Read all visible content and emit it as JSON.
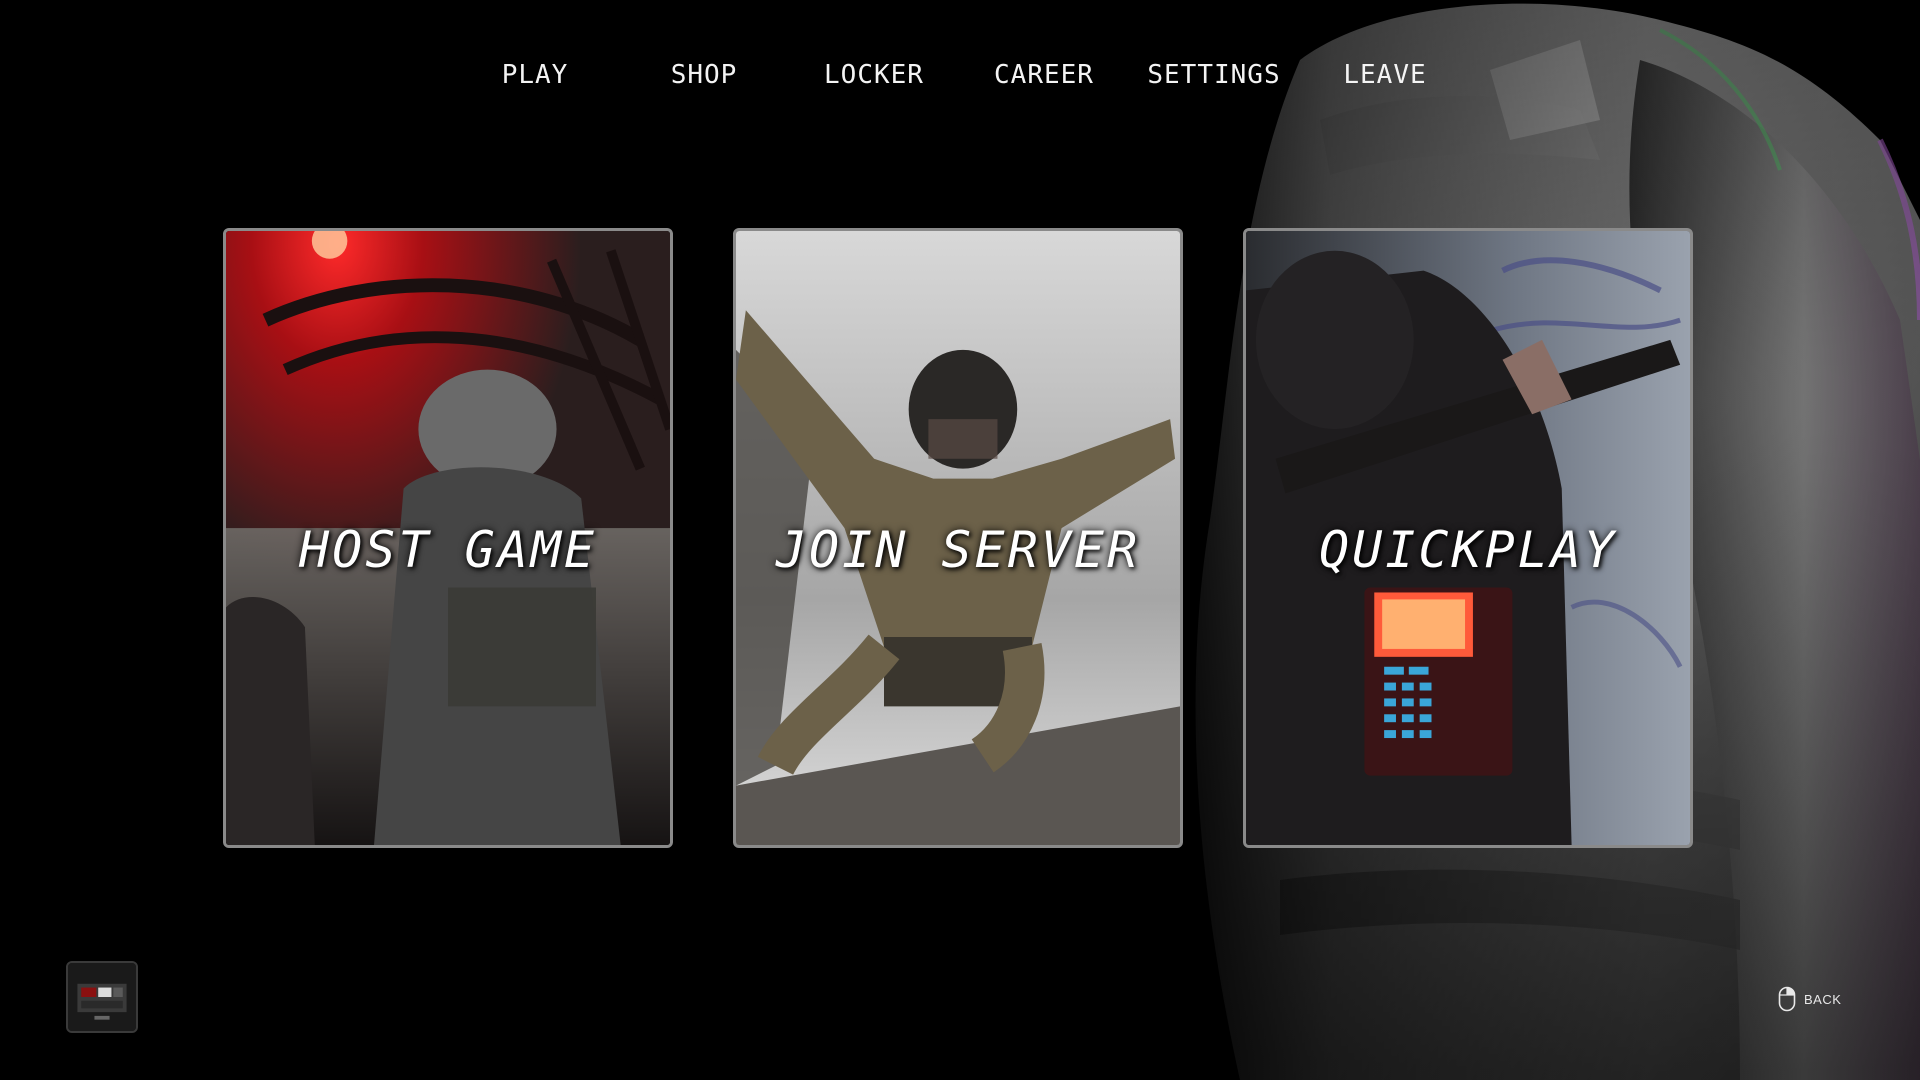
{
  "nav": {
    "items": [
      {
        "label": "PLAY"
      },
      {
        "label": "SHOP"
      },
      {
        "label": "LOCKER"
      },
      {
        "label": "CAREER"
      },
      {
        "label": "SETTINGS"
      },
      {
        "label": "LEAVE"
      }
    ]
  },
  "modes": [
    {
      "label": "HOST GAME",
      "image": "soldier-in-aircraft-red-light"
    },
    {
      "label": "JOIN SERVER",
      "image": "soldier-freefall-skydive"
    },
    {
      "label": "QUICKPLAY",
      "image": "soldier-with-rifle-and-bomb"
    }
  ],
  "footer": {
    "back_label": "BACK",
    "back_icon": "mouse-right-click-icon",
    "thumbnail": "mode-preview-thumbnail"
  },
  "colors": {
    "background": "#000000",
    "card_border": "#8a8a8a",
    "text": "#ffffff",
    "accent_red": "#c4101a"
  }
}
